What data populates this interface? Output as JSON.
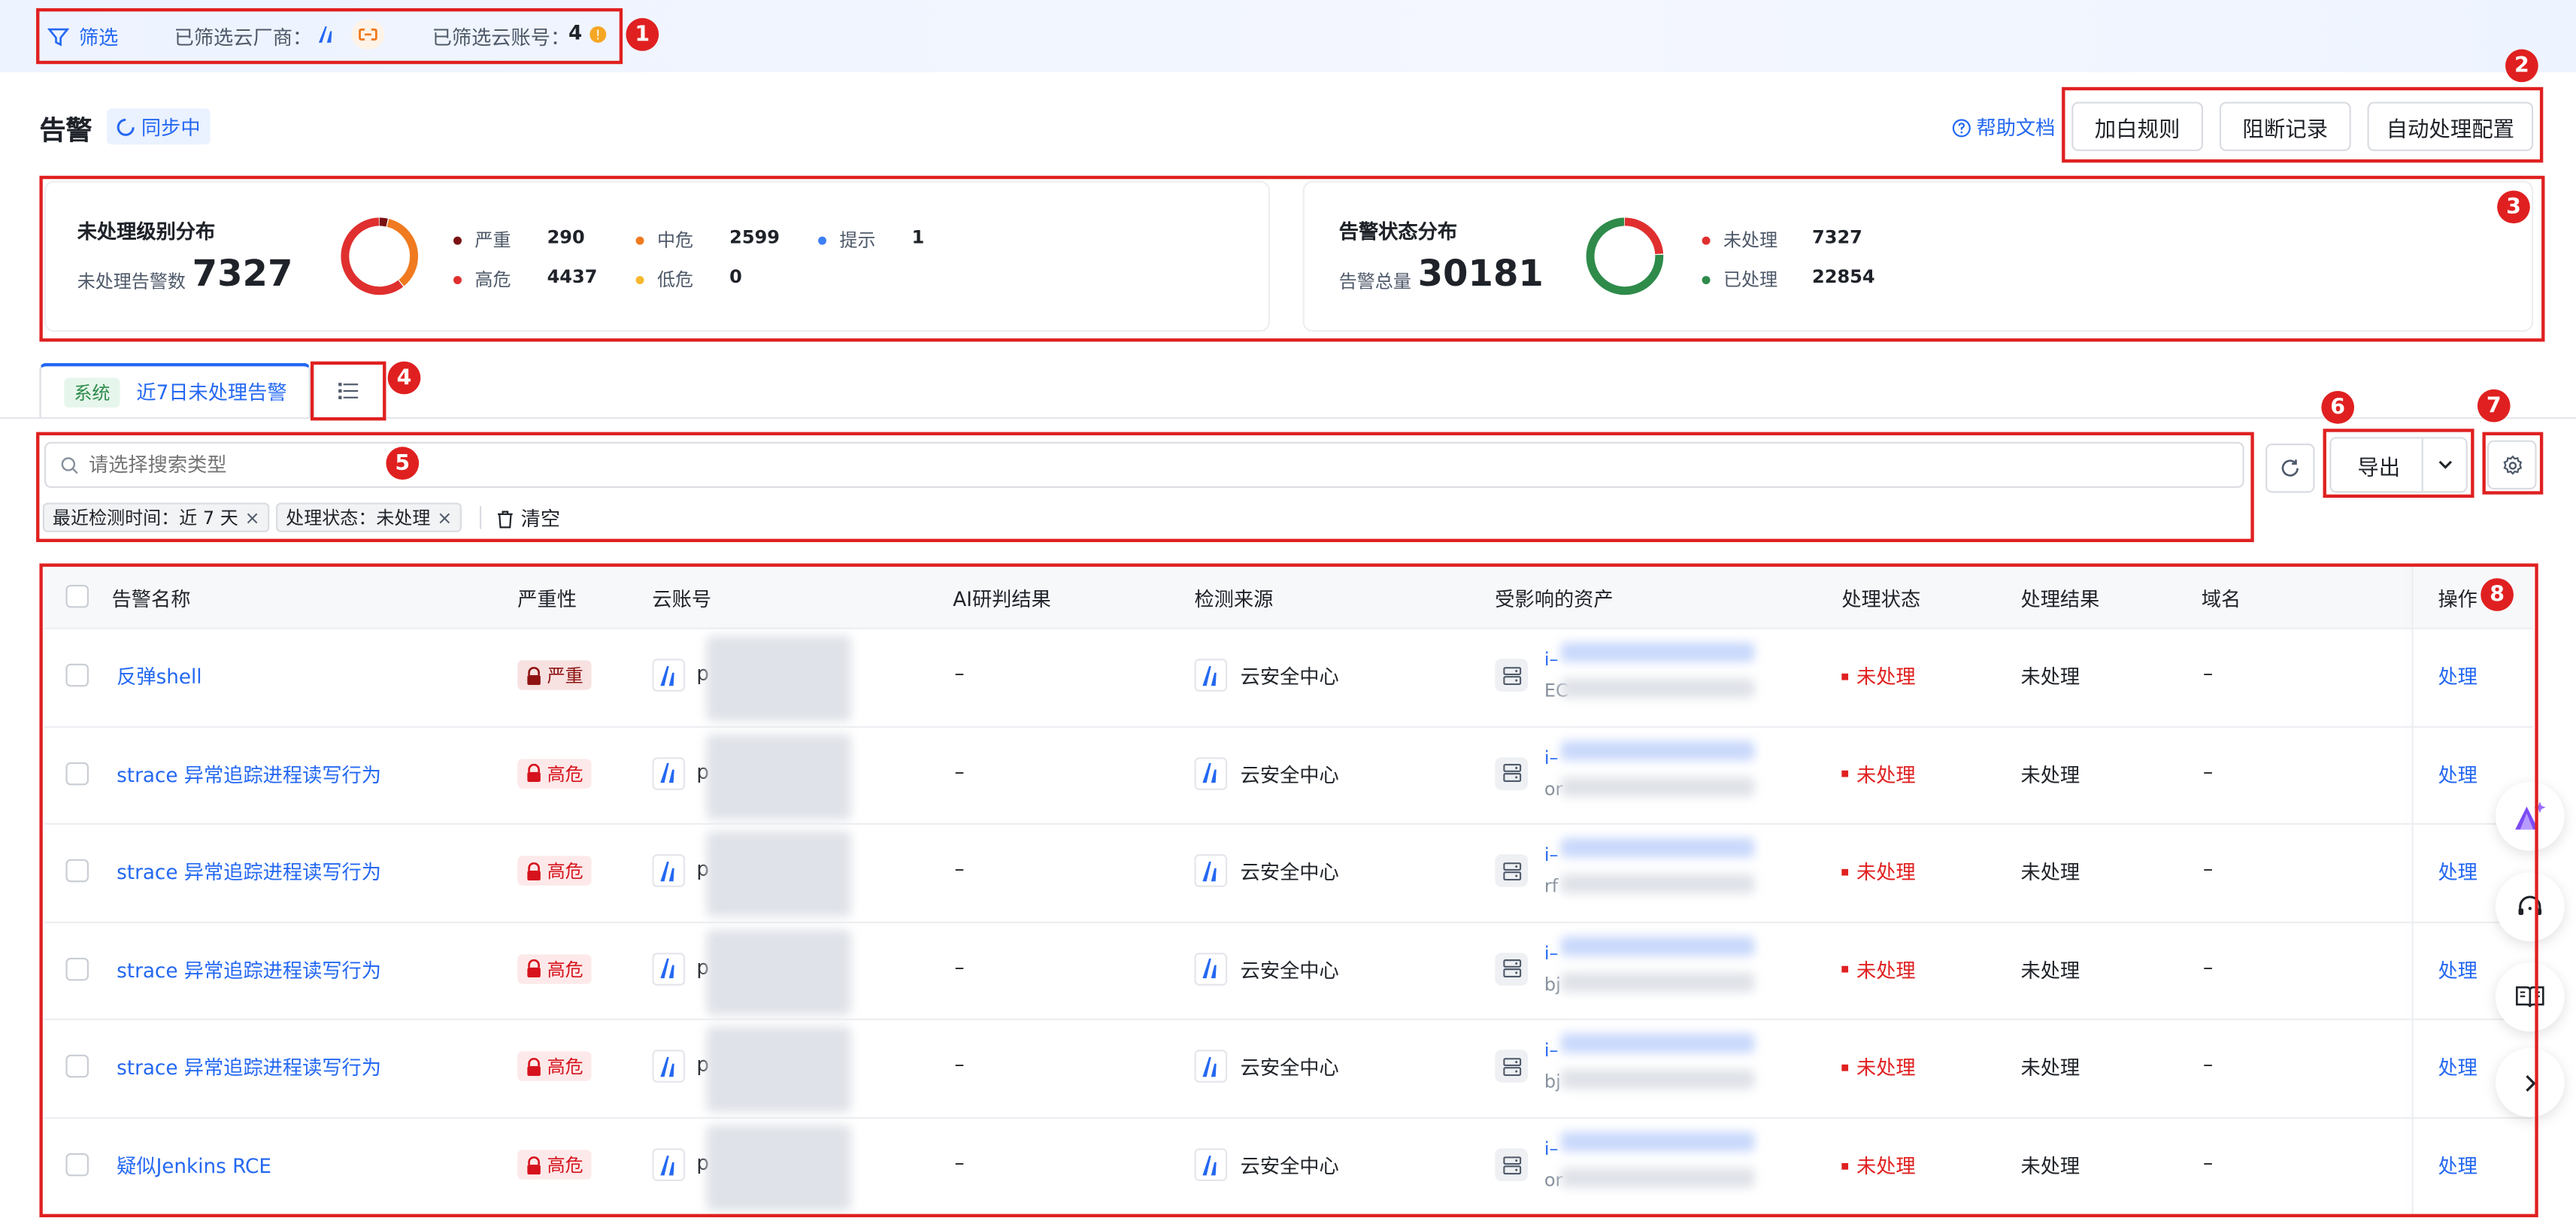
{
  "topbar": {
    "filter_label": "筛选",
    "vendor_label": "已筛选云厂商：",
    "account_label": "已筛选云账号：",
    "account_count": "4"
  },
  "header": {
    "title": "告警",
    "sync_status": "同步中",
    "help_link": "帮助文档",
    "buttons": [
      "加白规则",
      "阻断记录",
      "自动处理配置"
    ]
  },
  "level_card": {
    "title": "未处理级别分布",
    "sub_label": "未处理告警数",
    "total": "7327",
    "legend": [
      {
        "label": "严重",
        "value": "290",
        "color": "#7a1212"
      },
      {
        "label": "中危",
        "value": "2599",
        "color": "#f07a1f"
      },
      {
        "label": "提示",
        "value": "1",
        "color": "#3d7ff5"
      },
      {
        "label": "高危",
        "value": "4437",
        "color": "#e02f2f"
      },
      {
        "label": "低危",
        "value": "0",
        "color": "#f5b82e"
      }
    ]
  },
  "status_card": {
    "title": "告警状态分布",
    "sub_label": "告警总量",
    "total": "30181",
    "legend": [
      {
        "label": "未处理",
        "value": "7327",
        "color": "#e02f2f"
      },
      {
        "label": "已处理",
        "value": "22854",
        "color": "#2e8b4a"
      }
    ]
  },
  "tabs": {
    "system_tag": "系统",
    "active_label": "近7日未处理告警"
  },
  "search": {
    "placeholder": "请选择搜索类型",
    "filters": [
      "最近检测时间：近 7 天",
      "处理状态：未处理"
    ],
    "clear_label": "清空"
  },
  "toolbar": {
    "export_label": "导出"
  },
  "table": {
    "columns": [
      "告警名称",
      "严重性",
      "云账号",
      "AI研判结果",
      "检测来源",
      "受影响的资产",
      "处理状态",
      "处理结果",
      "域名",
      "操作"
    ],
    "rows": [
      {
        "name": "反弹shell",
        "severity": "严重",
        "account_prefix": "p",
        "ai": "–",
        "source": "云安全中心",
        "asset_prefix": "i–",
        "asset_sub": "EC",
        "status": "未处理",
        "result": "未处理",
        "domain": "–",
        "action": "处理"
      },
      {
        "name": "strace 异常追踪进程读写行为",
        "severity": "高危",
        "account_prefix": "p",
        "ai": "–",
        "source": "云安全中心",
        "asset_prefix": "i–",
        "asset_sub": "or",
        "status": "未处理",
        "result": "未处理",
        "domain": "–",
        "action": "处理"
      },
      {
        "name": "strace 异常追踪进程读写行为",
        "severity": "高危",
        "account_prefix": "p",
        "ai": "–",
        "source": "云安全中心",
        "asset_prefix": "i–",
        "asset_sub": "rf",
        "status": "未处理",
        "result": "未处理",
        "domain": "–",
        "action": "处理"
      },
      {
        "name": "strace 异常追踪进程读写行为",
        "severity": "高危",
        "account_prefix": "p",
        "ai": "–",
        "source": "云安全中心",
        "asset_prefix": "i–",
        "asset_sub": "bj",
        "status": "未处理",
        "result": "未处理",
        "domain": "–",
        "action": "处理"
      },
      {
        "name": "strace 异常追踪进程读写行为",
        "severity": "高危",
        "account_prefix": "p",
        "ai": "–",
        "source": "云安全中心",
        "asset_prefix": "i–",
        "asset_sub": "bj",
        "status": "未处理",
        "result": "未处理",
        "domain": "–",
        "action": "处理"
      },
      {
        "name": "疑似Jenkins RCE",
        "severity": "高危",
        "account_prefix": "p",
        "ai": "–",
        "source": "云安全中心",
        "asset_prefix": "i–",
        "asset_sub": "or",
        "status": "未处理",
        "result": "未处理",
        "domain": "–",
        "action": "处理"
      }
    ]
  },
  "annotations": [
    "1",
    "2",
    "3",
    "4",
    "5",
    "6",
    "7",
    "8"
  ],
  "icons": {
    "filter": "filter-icon",
    "sync": "loading-spinner-icon",
    "help": "question-circle-icon",
    "search": "search-icon",
    "refresh": "refresh-icon",
    "settings": "gear-icon",
    "list": "list-icon",
    "trash": "trash-icon"
  },
  "colors": {
    "accent": "#2468f2",
    "danger": "#e02020",
    "success": "#2e8b4a"
  }
}
